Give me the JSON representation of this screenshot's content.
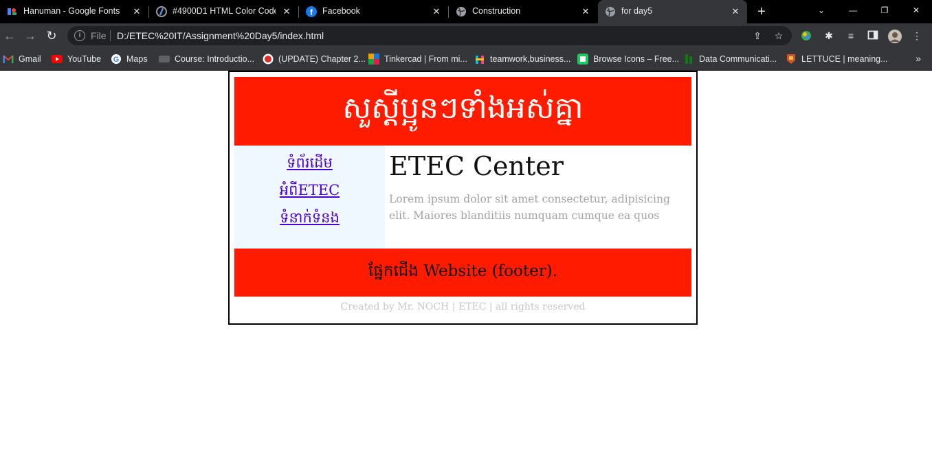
{
  "browser": {
    "tabs": [
      {
        "title": "Hanuman - Google Fonts",
        "icon": "google-fonts-icon"
      },
      {
        "title": "#4900D1 HTML Color Code",
        "icon": "color-code-icon"
      },
      {
        "title": "Facebook",
        "icon": "facebook-icon"
      },
      {
        "title": "Construction",
        "icon": "globe-icon"
      },
      {
        "title": "for day5",
        "icon": "globe-icon",
        "active": true
      }
    ],
    "address": {
      "protocol_label": "File",
      "url": "D:/ETEC%20IT/Assignment%20Day5/index.html"
    },
    "bookmarks": [
      {
        "label": "Gmail",
        "icon": "gmail-icon"
      },
      {
        "label": "YouTube",
        "icon": "youtube-icon"
      },
      {
        "label": "Maps",
        "icon": "google-maps-icon"
      },
      {
        "label": "Course: Introductio...",
        "icon": "course-icon"
      },
      {
        "label": "(UPDATE) Chapter 2...",
        "icon": "chapter-icon"
      },
      {
        "label": "Tinkercad | From mi...",
        "icon": "tinkercad-icon"
      },
      {
        "label": "teamwork,business...",
        "icon": "teamwork-icon"
      },
      {
        "label": "Browse Icons – Free...",
        "icon": "icons-site-icon"
      },
      {
        "label": "Data Communicati...",
        "icon": "data-comm-icon"
      },
      {
        "label": "LETTUCE | meaning...",
        "icon": "dictionary-icon"
      }
    ],
    "more_bookmarks_label": "»"
  },
  "page": {
    "header_title": "សួស្តីប្អូនៗទាំងអស់គ្នា",
    "nav_links": [
      {
        "label": "ទំព័រដើម"
      },
      {
        "label": "អំពីETEC"
      },
      {
        "label": "ទំនាក់ទំនង"
      }
    ],
    "main_heading": "ETEC Center",
    "main_paragraph": "Lorem ipsum dolor sit amet consectetur, adipisicing elit. Maiores blanditiis numquam cumque ea quos",
    "footer_text": "ផ្នែកជើង Website (footer).",
    "credit": "Created by Mr. NOCH | ETEC | all rights reserved"
  },
  "colors": {
    "header_bg": "#ff1b00",
    "sidebar_bg": "#f0f8ff",
    "link": "#4900d1",
    "browser_dark": "#35363a"
  }
}
